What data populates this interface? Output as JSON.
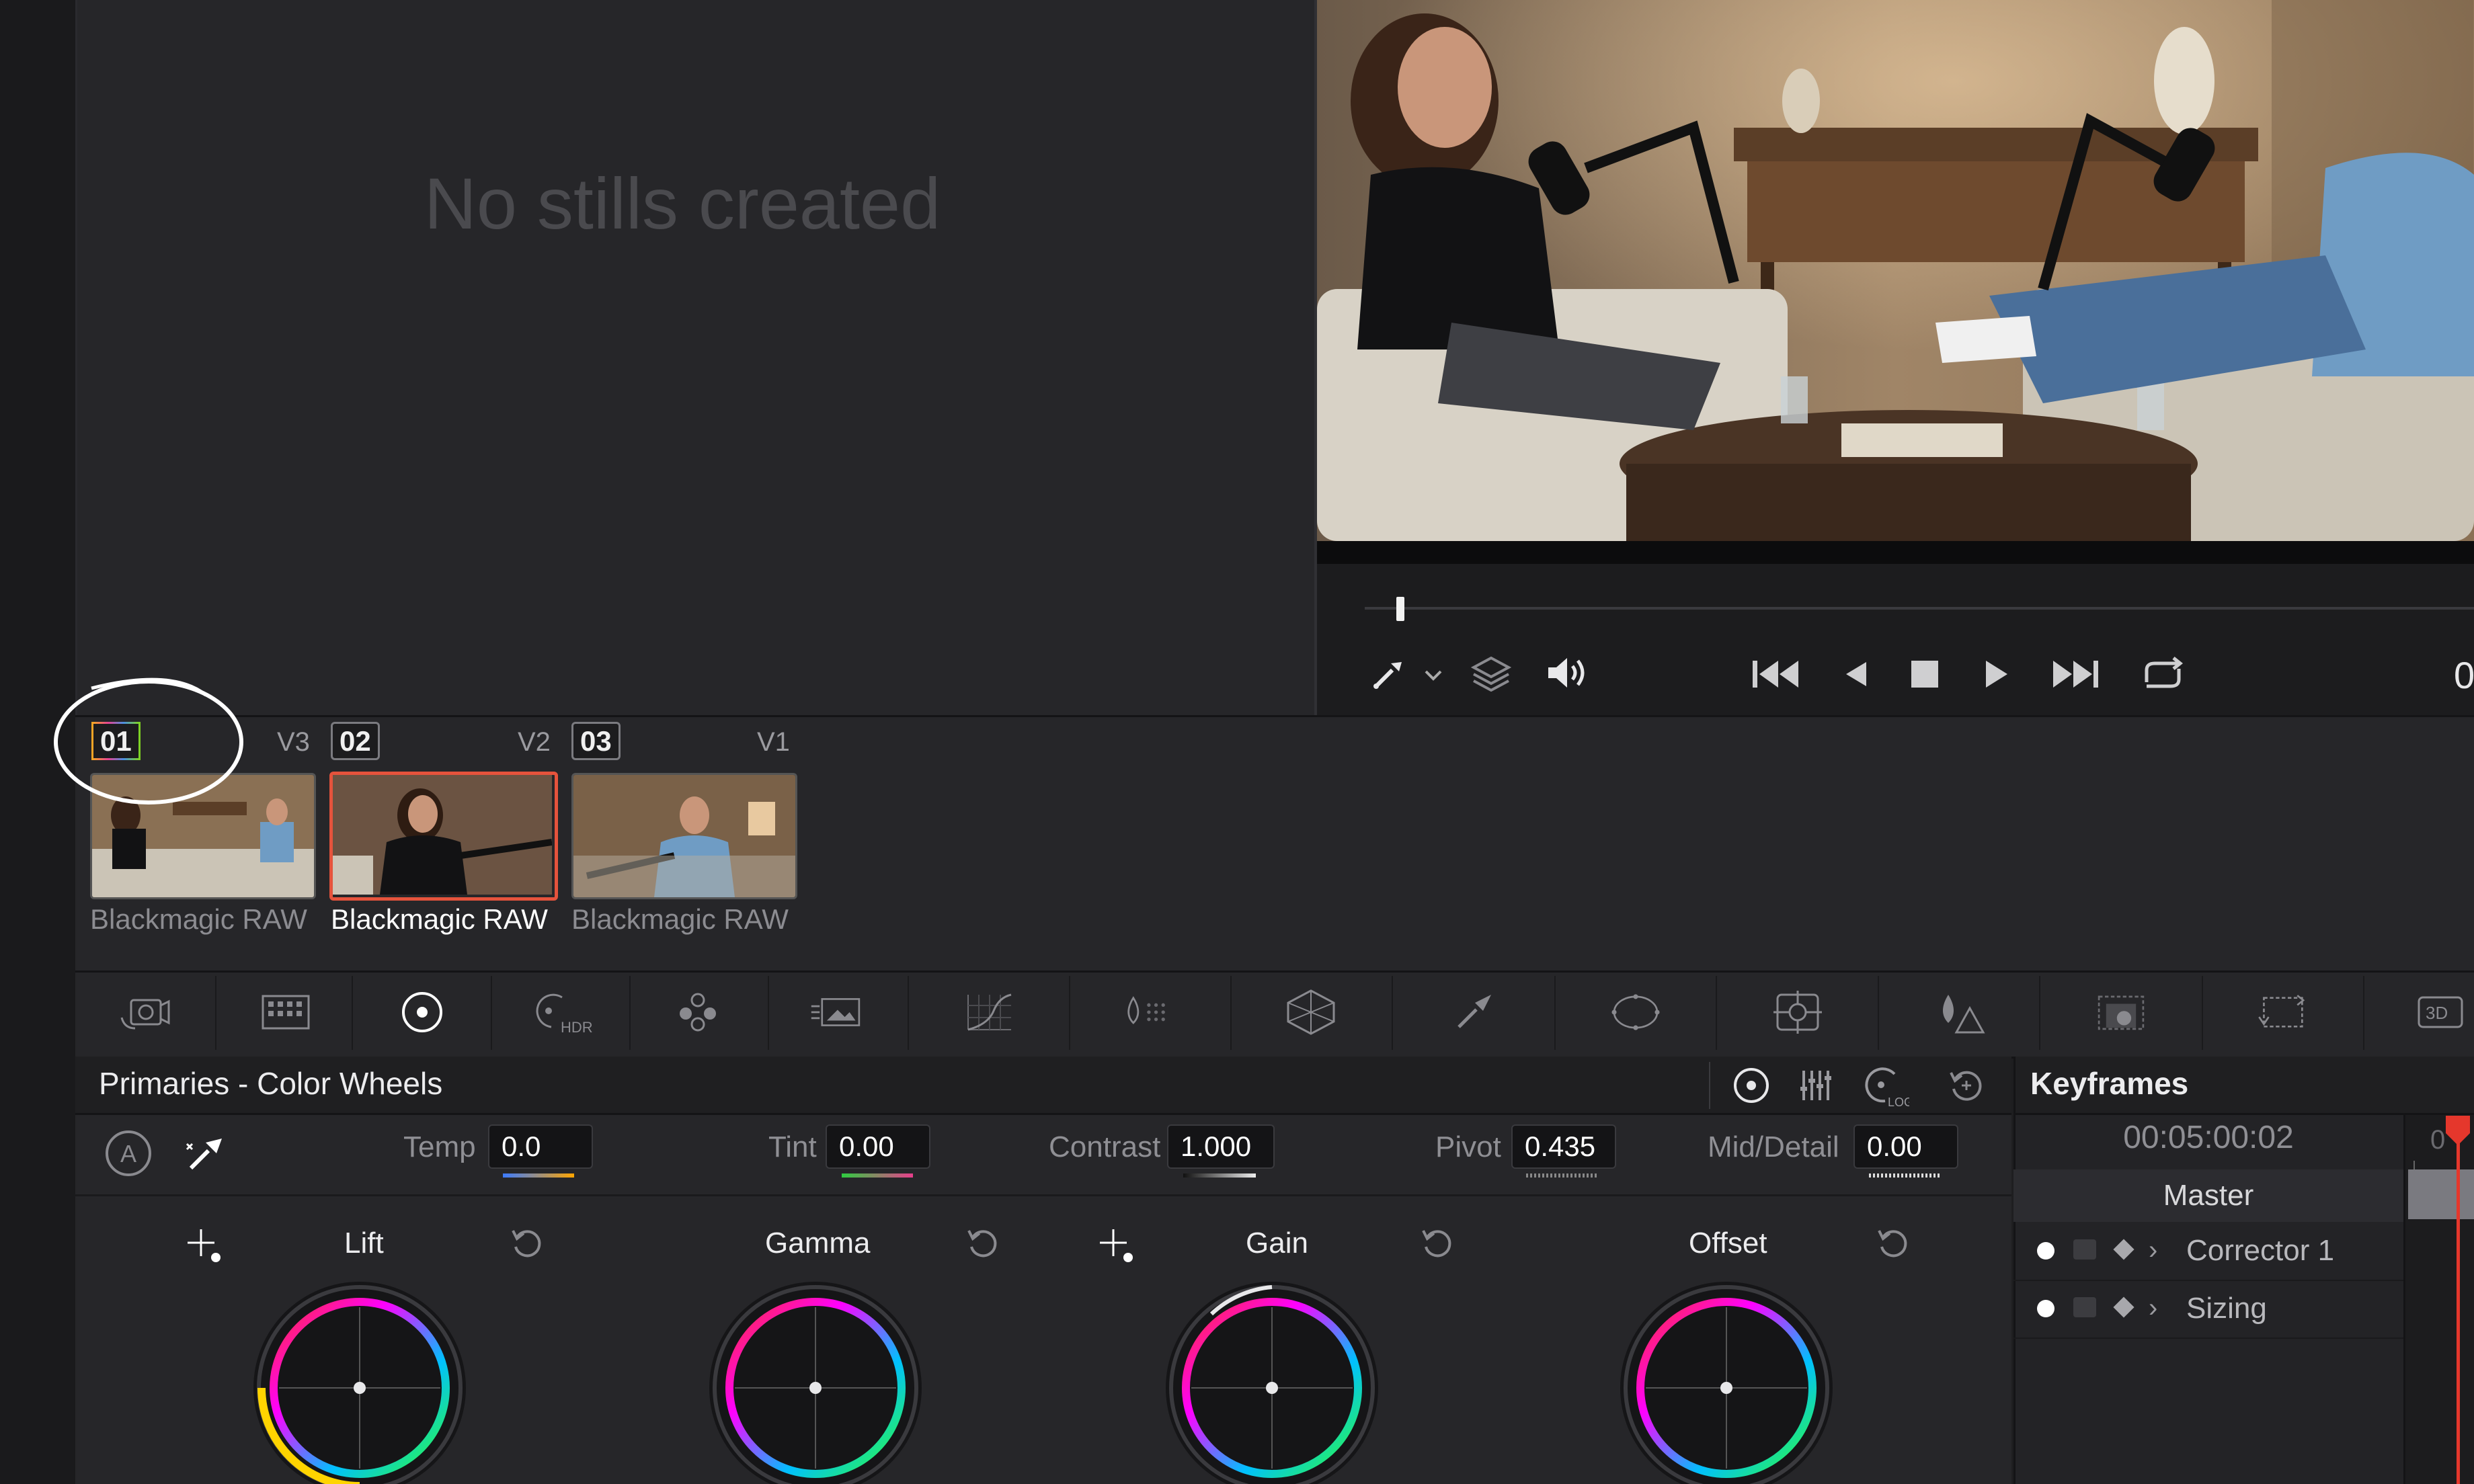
{
  "gallery": {
    "empty_message": "No stills created"
  },
  "viewer": {
    "timecode": "0",
    "transport": [
      "picker-icon",
      "chevron-down-icon",
      "layers-icon",
      "speaker-icon",
      "skip-start-icon",
      "step-back-icon",
      "stop-icon",
      "play-icon",
      "skip-end-icon",
      "loop-icon"
    ]
  },
  "clips": [
    {
      "number": "01",
      "track": "V3",
      "label": "Blackmagic RAW",
      "selected": false
    },
    {
      "number": "02",
      "track": "V2",
      "label": "Blackmagic RAW",
      "selected": true
    },
    {
      "number": "03",
      "track": "V1",
      "label": "Blackmagic RAW",
      "selected": false
    }
  ],
  "palette_icons": [
    "camera-raw-icon",
    "color-match-icon",
    "color-wheels-icon",
    "hdr-icon",
    "rgb-mixer-icon",
    "motion-effects-icon",
    "curves-icon",
    "color-warper-icon",
    "qualifier-icon",
    "window-icon",
    "tracker-icon",
    "magic-mask-icon",
    "blur-icon",
    "key-icon",
    "sizing-icon",
    "3d-icon"
  ],
  "palette_labels": {
    "hdr": "HDR",
    "three_d": "3D",
    "log": "LOG"
  },
  "primaries": {
    "title": "Primaries - Color Wheels",
    "auto_label": "A",
    "adjust": [
      {
        "label": "Temp",
        "value": "0.0"
      },
      {
        "label": "Tint",
        "value": "0.00"
      },
      {
        "label": "Contrast",
        "value": "1.000"
      },
      {
        "label": "Pivot",
        "value": "0.435"
      },
      {
        "label": "Mid/Detail",
        "value": "0.00"
      }
    ],
    "wheels": [
      "Lift",
      "Gamma",
      "Gain",
      "Offset"
    ]
  },
  "keyframes": {
    "title": "Keyframes",
    "timecode": "00:05:00:02",
    "master": "Master",
    "rows": [
      "Corrector 1",
      "Sizing"
    ],
    "lane_label": "0"
  },
  "colors": {
    "accent_red": "#e5533c",
    "playhead": "#e5372c",
    "panel": "#262629"
  }
}
